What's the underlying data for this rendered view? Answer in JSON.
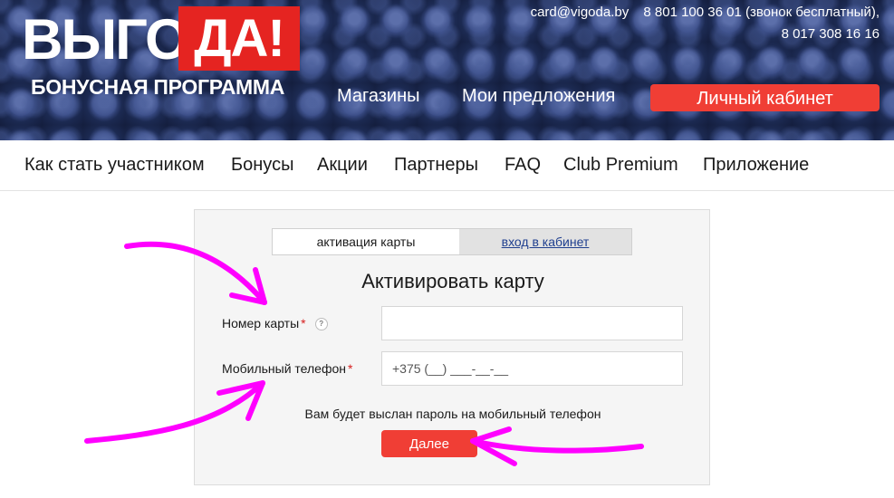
{
  "brand": {
    "logo_part1": "ВЫГО",
    "logo_part2": "ДА!",
    "subtitle": "БОНУСНАЯ ПРОГРАММА",
    "accent_color": "#e52421"
  },
  "contacts": {
    "email": "card@vigoda.by",
    "phone1": "8 801 100 36 01 (звонок бесплатный),",
    "phone2": "8 017 308 16 16"
  },
  "top_nav": {
    "stores": "Магазины",
    "offers": "Мои предложения",
    "cabinet": "Личный кабинет"
  },
  "main_nav": [
    "Как стать участником",
    "Бонусы",
    "Акции",
    "Партнеры",
    "FAQ",
    "Club Premium",
    "Приложение"
  ],
  "form": {
    "tab_active": "активация карты",
    "tab_inactive": "вход в кабинет",
    "title": "Активировать карту",
    "card_label": "Номер карты",
    "required_mark": "*",
    "help_mark": "?",
    "phone_label": "Мобильный телефон",
    "card_value": "",
    "phone_placeholder": "+375 (__) ___-__-__",
    "hint": "Вам будет выслан пароль на мобильный телефон",
    "submit": "Далее"
  },
  "annotation_color": "#ff00ff",
  "icons": [
    "help-icon"
  ]
}
